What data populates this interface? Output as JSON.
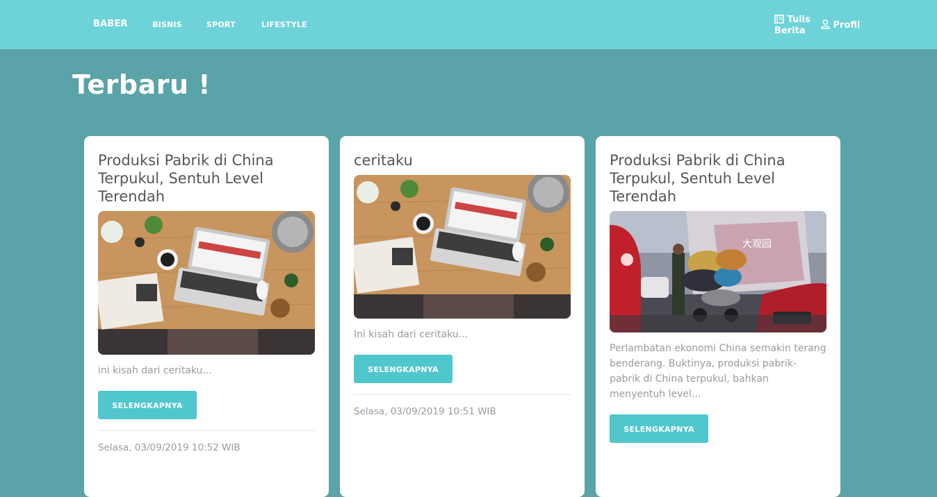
{
  "nav": {
    "brand": "BABER",
    "links": [
      "BISNIS",
      "SPORT",
      "LIFESTYLE"
    ],
    "write_label_line1": "Tulis",
    "write_label_line2": "Berita",
    "profile_label": "Profil"
  },
  "main": {
    "heading": "Terbaru !"
  },
  "cards": [
    {
      "title": "Produksi Pabrik di China Terpukul, Sentuh Level Terendah",
      "image": "desk-laptop-photo",
      "excerpt": "ini kisah dari ceritaku...",
      "button_label": "SELENGKAPNYA",
      "date": "Selasa, 03/09/2019 10:52 WIB"
    },
    {
      "title": "ceritaku",
      "image": "desk-laptop-photo",
      "excerpt": "Ini kisah dari ceritaku...",
      "button_label": "SELENGKAPNYA",
      "date": "Selasa, 03/09/2019 10:51 WIB"
    },
    {
      "title": "Produksi Pabrik di China Terpukul, Sentuh Level Terendah",
      "image": "street-cargo-photo",
      "sign_text": "大观园",
      "excerpt": "Perlambatan ekonomi China semakin terang benderang. Buktinya, produksi pabrik-pabrik di China terpukul, bahkan menyentuh level...",
      "button_label": "SELENGKAPNYA",
      "date": ""
    }
  ],
  "colors": {
    "navbar": "#6dd3d8",
    "page_background": "#5aa3a8",
    "button": "#4fc7cc"
  }
}
